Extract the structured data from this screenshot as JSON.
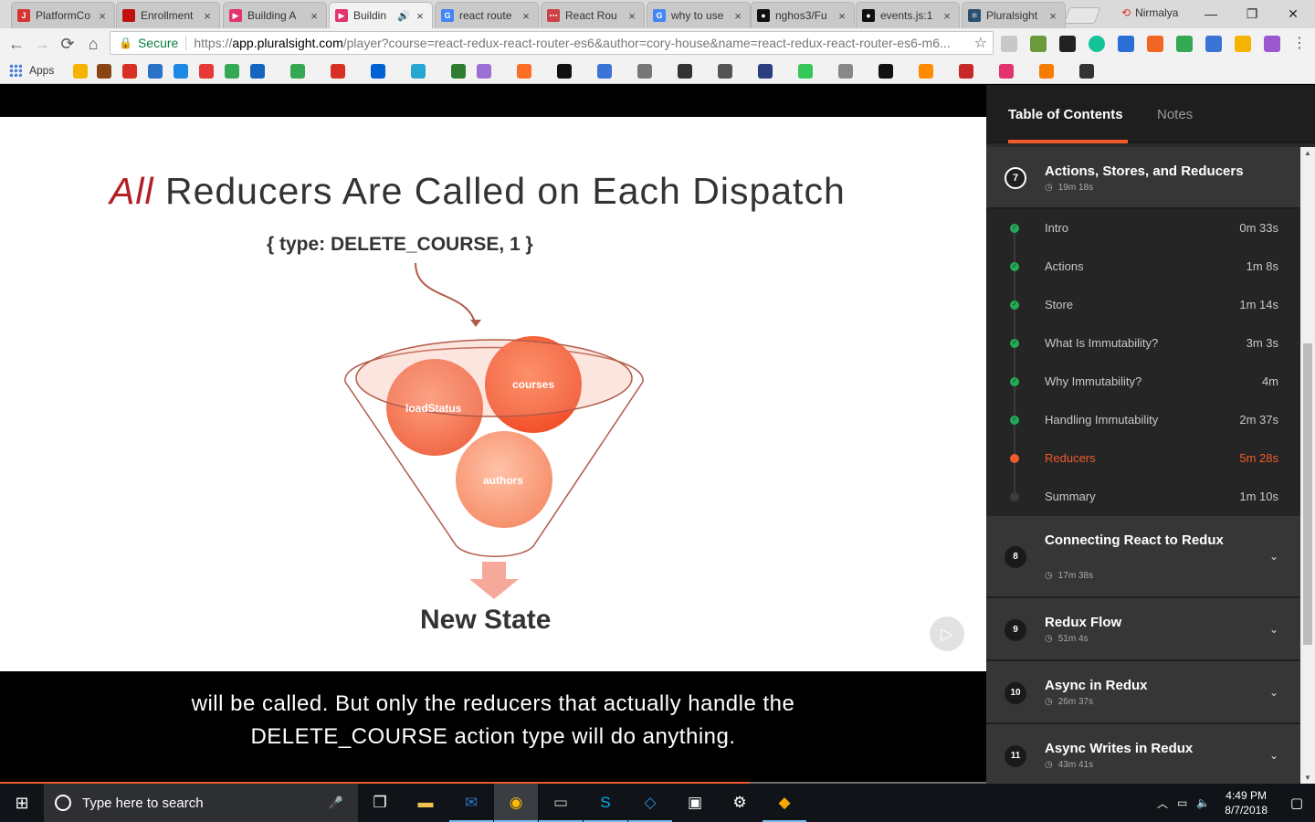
{
  "browser": {
    "tabs": [
      {
        "title": "PlatformCo",
        "favicon_color": "#d73333",
        "favicon_text": "J"
      },
      {
        "title": "Enrollment",
        "favicon_color": "#c01010",
        "favicon_text": ""
      },
      {
        "title": "Building A",
        "favicon_color": "#e2336f",
        "favicon_text": "▶"
      },
      {
        "title": "Buildin",
        "favicon_color": "#e2336f",
        "favicon_text": "▶",
        "audio": "🔊",
        "active": true
      },
      {
        "title": "react route",
        "favicon_color": "#4285f4",
        "favicon_text": "G"
      },
      {
        "title": "React Rou",
        "favicon_color": "#ca4245",
        "favicon_text": "⋯"
      },
      {
        "title": "why to use",
        "favicon_color": "#4285f4",
        "favicon_text": "G"
      },
      {
        "title": "nghos3/Fu",
        "favicon_color": "#111111",
        "favicon_text": "●"
      },
      {
        "title": "events.js:1",
        "favicon_color": "#111111",
        "favicon_text": "●"
      },
      {
        "title": "Pluralsight",
        "favicon_color": "#2a4f6f",
        "favicon_text": "⚛"
      }
    ],
    "profile_name": "Nirmalya",
    "window_controls": {
      "minimize": "—",
      "maximize": "❐",
      "close": "✕"
    },
    "nav": {
      "back": "←",
      "forward": "→",
      "reload": "⟳",
      "home": "⌂"
    },
    "omnibox": {
      "secure_label": "Secure",
      "url_scheme": "https://",
      "url_host": "app.pluralsight.com",
      "url_path": "/player?course=react-redux-react-router-es6&author=cory-house&name=react-redux-react-router-es6-m6..."
    },
    "bookmarks_apps_label": "Apps"
  },
  "player": {
    "slide": {
      "title_emphasis": "All",
      "title_rest": " Reducers Are Called on Each Dispatch",
      "action_label": "{ type: DELETE_COURSE, 1 }",
      "balls": {
        "courses": "courses",
        "loadStatus": "loadStatus",
        "authors": "authors"
      },
      "output_label": "New State"
    },
    "caption_line1": "will be called. But only the reducers that actually handle the",
    "caption_line2": "DELETE_COURSE action type will do anything.",
    "progress": 0.76
  },
  "sidebar": {
    "tabs": {
      "toc": "Table of Contents",
      "notes": "Notes"
    },
    "current_module": {
      "number": "7",
      "title": "Actions, Stores, and Reducers",
      "duration": "19m 18s",
      "clips": [
        {
          "title": "Intro",
          "duration": "0m 33s",
          "state": "done"
        },
        {
          "title": "Actions",
          "duration": "1m 8s",
          "state": "done"
        },
        {
          "title": "Store",
          "duration": "1m 14s",
          "state": "done"
        },
        {
          "title": "What Is Immutability?",
          "duration": "3m 3s",
          "state": "done"
        },
        {
          "title": "Why Immutability?",
          "duration": "4m",
          "state": "done"
        },
        {
          "title": "Handling Immutability",
          "duration": "2m 37s",
          "state": "done"
        },
        {
          "title": "Reducers",
          "duration": "5m 28s",
          "state": "current"
        },
        {
          "title": "Summary",
          "duration": "1m 10s",
          "state": "todo"
        }
      ]
    },
    "modules": [
      {
        "number": "8",
        "title": "Connecting React to Redux",
        "duration": "17m 38s"
      },
      {
        "number": "9",
        "title": "Redux Flow",
        "duration": "51m 4s"
      },
      {
        "number": "10",
        "title": "Async in Redux",
        "duration": "26m 37s"
      },
      {
        "number": "11",
        "title": "Async Writes in Redux",
        "duration": "43m 41s"
      }
    ]
  },
  "taskbar": {
    "search_placeholder": "Type here to search",
    "time": "4:49 PM",
    "date": "8/7/2018"
  },
  "colors": {
    "accent": "#f15b2a",
    "done": "#22aa55"
  }
}
